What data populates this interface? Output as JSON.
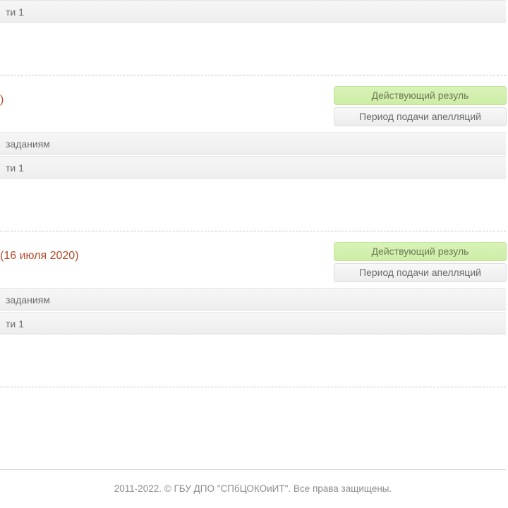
{
  "blocks": [
    {
      "rows": [
        {
          "label": "ти 1"
        }
      ]
    },
    {
      "date_heading": ")",
      "status_green": "Действующий резуль",
      "status_gray": "Период подачи апелляций",
      "rows": [
        {
          "label": " заданиям"
        },
        {
          "label": "ти 1"
        }
      ]
    },
    {
      "date_heading": "(16 июля 2020)",
      "status_green": "Действующий резуль",
      "status_gray": "Период подачи апелляций",
      "rows": [
        {
          "label": " заданиям"
        },
        {
          "label": "ти 1"
        }
      ]
    }
  ],
  "footer": "2011-2022. © ГБУ ДПО \"СПбЦОКОиИТ\". Все права защищены."
}
